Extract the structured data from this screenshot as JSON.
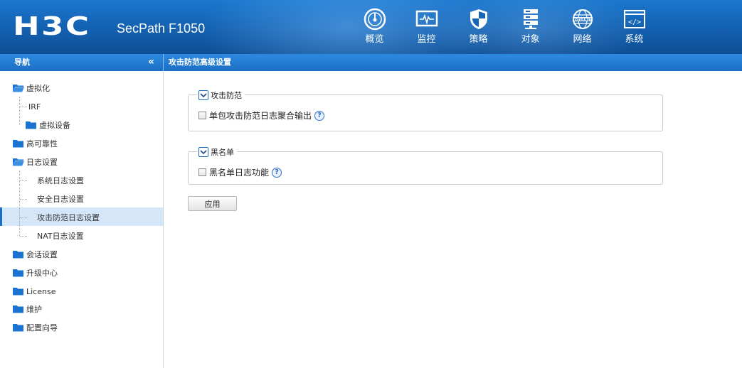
{
  "header": {
    "logo": "H3C",
    "product": "SecPath F1050",
    "tabs": [
      {
        "label": "概览",
        "icon": "dashboard-icon"
      },
      {
        "label": "监控",
        "icon": "monitor-icon"
      },
      {
        "label": "策略",
        "icon": "shield-icon"
      },
      {
        "label": "对象",
        "icon": "server-stack-icon"
      },
      {
        "label": "网络",
        "icon": "internet-globe-icon"
      },
      {
        "label": "系统",
        "icon": "code-window-icon"
      }
    ],
    "active_tab": "系统"
  },
  "subbar": {
    "nav_title": "导航",
    "collapse_glyph": "«",
    "page_title": "攻击防范高级设置"
  },
  "sidebar": {
    "items": [
      {
        "label": "虚拟化",
        "level": 0,
        "icon": "folder-open-icon"
      },
      {
        "label": "IRF",
        "level": 1,
        "icon": ""
      },
      {
        "label": "虚拟设备",
        "level": 1,
        "icon": "folder-icon"
      },
      {
        "label": "高可靠性",
        "level": 0,
        "icon": "folder-icon"
      },
      {
        "label": "日志设置",
        "level": 0,
        "icon": "folder-open-icon"
      },
      {
        "label": "系统日志设置",
        "level": 1,
        "icon": ""
      },
      {
        "label": "安全日志设置",
        "level": 1,
        "icon": ""
      },
      {
        "label": "攻击防范日志设置",
        "level": 1,
        "icon": "",
        "selected": true
      },
      {
        "label": "NAT日志设置",
        "level": 1,
        "icon": ""
      },
      {
        "label": "会话设置",
        "level": 0,
        "icon": "folder-icon"
      },
      {
        "label": "升级中心",
        "level": 0,
        "icon": "folder-icon"
      },
      {
        "label": "License",
        "level": 0,
        "icon": "folder-icon"
      },
      {
        "label": "维护",
        "level": 0,
        "icon": "folder-icon"
      },
      {
        "label": "配置向导",
        "level": 0,
        "icon": "folder-icon"
      }
    ]
  },
  "main": {
    "sections": [
      {
        "legend": "攻击防范",
        "option": "单包攻击防范日志聚合输出",
        "checked": false
      },
      {
        "legend": "黑名单",
        "option": "黑名单日志功能",
        "checked": false
      }
    ],
    "apply_label": "应用"
  },
  "colors": {
    "header_blue": "#1566b8",
    "subbar_blue": "#1a6fc4",
    "folder_blue": "#1a73d1",
    "selected_bg": "#d4e6f8"
  }
}
